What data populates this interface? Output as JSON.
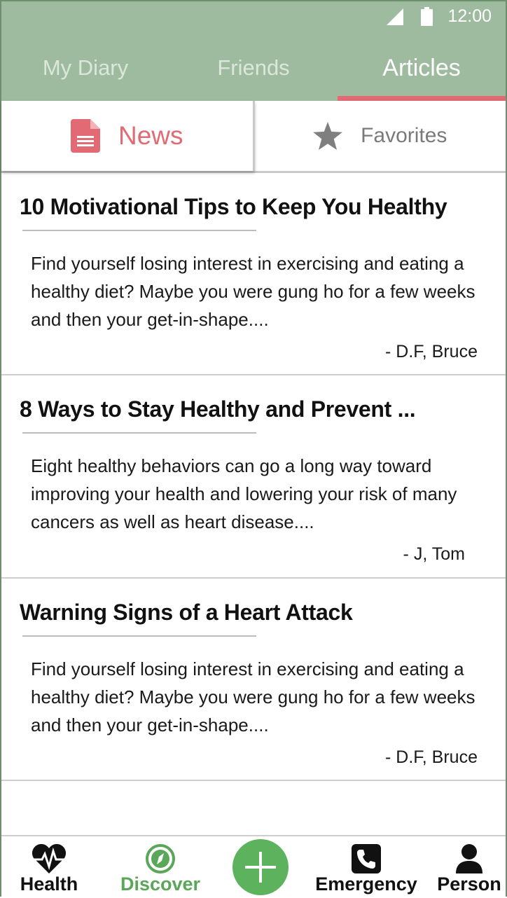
{
  "status_bar": {
    "time": "12:00"
  },
  "tabs": [
    {
      "label": "My Diary",
      "active": false
    },
    {
      "label": "Friends",
      "active": false
    },
    {
      "label": "Articles",
      "active": true
    }
  ],
  "subtabs": [
    {
      "label": "News",
      "icon": "document-icon",
      "active": true
    },
    {
      "label": "Favorites",
      "icon": "star-icon",
      "active": false
    }
  ],
  "articles": [
    {
      "title": "10 Motivational Tips to Keep You Healthy",
      "excerpt": "Find yourself losing interest in exercising and eating a healthy diet? Maybe you were gung ho for a few weeks and then your get-in-shape....",
      "author": "- D.F, Bruce"
    },
    {
      "title": "8 Ways to Stay Healthy and Prevent ...",
      "excerpt": "Eight healthy behaviors can go a long way toward improving your health and lowering your risk of many cancers as well as heart disease....",
      "author": "- J, Tom"
    },
    {
      "title": "Warning Signs of a Heart Attack",
      "excerpt": "Find yourself losing interest in exercising and eating a healthy diet? Maybe you were gung ho for a few weeks and then your get-in-shape....",
      "author": "- D.F, Bruce"
    }
  ],
  "bottom_nav": [
    {
      "label": "Health",
      "icon": "heart-pulse-icon"
    },
    {
      "label": "Discover",
      "icon": "compass-icon",
      "active": true
    },
    {
      "label": "",
      "icon": "plus-icon"
    },
    {
      "label": "Emergency",
      "icon": "phone-icon"
    },
    {
      "label": "Person",
      "icon": "person-icon"
    }
  ],
  "colors": {
    "header": "#9fbb9f",
    "accent": "#e26a74",
    "nav_active": "#5aa75a",
    "fab": "#5db25d"
  }
}
